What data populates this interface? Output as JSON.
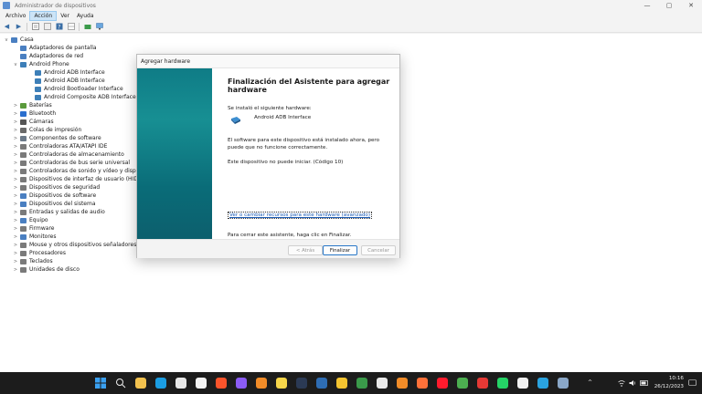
{
  "window": {
    "title": "Administrador de dispositivos",
    "min": "—",
    "max": "▢",
    "close": "✕"
  },
  "menu": [
    "Archivo",
    "Acción",
    "Ver",
    "Ayuda"
  ],
  "toolbar_icons": [
    "back-arrow-icon",
    "forward-arrow-icon",
    "properties-icon",
    "list-icon",
    "help-icon",
    "grid-icon",
    "update-driver-icon",
    "monitor-scan-icon"
  ],
  "tree": {
    "root": "Casa",
    "items": [
      {
        "label": "Adaptadores de pantalla",
        "expander": "",
        "color": "#4a7fc1"
      },
      {
        "label": "Adaptadores de red",
        "expander": "",
        "color": "#4a7fc1"
      },
      {
        "label": "Android Phone",
        "expander": "v",
        "color": "#3d7fb8"
      },
      {
        "label": "Android ADB Interface",
        "expander": "",
        "color": "#3d7fb8",
        "child": true
      },
      {
        "label": "Android ADB Interface",
        "expander": "",
        "color": "#3d7fb8",
        "child": true
      },
      {
        "label": "Android Bootloader Interface",
        "expander": "",
        "color": "#3d7fb8",
        "child": true
      },
      {
        "label": "Android Composite ADB Interface",
        "expander": "",
        "color": "#3d7fb8",
        "child": true
      },
      {
        "label": "Baterías",
        "expander": ">",
        "color": "#5a9a3c"
      },
      {
        "label": "Bluetooth",
        "expander": ">",
        "color": "#2b6fce"
      },
      {
        "label": "Cámaras",
        "expander": ">",
        "color": "#555555"
      },
      {
        "label": "Colas de impresión",
        "expander": ">",
        "color": "#6a6a6a"
      },
      {
        "label": "Componentes de software",
        "expander": ">",
        "color": "#6c7a89"
      },
      {
        "label": "Controladoras ATA/ATAPI IDE",
        "expander": ">",
        "color": "#7a7a7a"
      },
      {
        "label": "Controladoras de almacenamiento",
        "expander": ">",
        "color": "#7a7a7a"
      },
      {
        "label": "Controladoras de bus serie universal",
        "expander": ">",
        "color": "#7a7a7a"
      },
      {
        "label": "Controladoras de sonido y vídeo y dispositivos de juego",
        "expander": ">",
        "color": "#7a7a7a"
      },
      {
        "label": "Dispositivos de interfaz de usuario (HID)",
        "expander": ">",
        "color": "#7a7a7a"
      },
      {
        "label": "Dispositivos de seguridad",
        "expander": ">",
        "color": "#7a7a7a"
      },
      {
        "label": "Dispositivos de software",
        "expander": ">",
        "color": "#4a7fc1"
      },
      {
        "label": "Dispositivos del sistema",
        "expander": ">",
        "color": "#4a7fc1"
      },
      {
        "label": "Entradas y salidas de audio",
        "expander": ">",
        "color": "#7a7a7a"
      },
      {
        "label": "Equipo",
        "expander": ">",
        "color": "#4a7fc1"
      },
      {
        "label": "Firmware",
        "expander": ">",
        "color": "#7a7a7a"
      },
      {
        "label": "Monitores",
        "expander": ">",
        "color": "#4a7fc1"
      },
      {
        "label": "Mouse y otros dispositivos señaladores",
        "expander": ">",
        "color": "#7a7a7a"
      },
      {
        "label": "Procesadores",
        "expander": ">",
        "color": "#7a7a7a"
      },
      {
        "label": "Teclados",
        "expander": ">",
        "color": "#7a7a7a"
      },
      {
        "label": "Unidades de disco",
        "expander": ">",
        "color": "#7a7a7a"
      }
    ]
  },
  "dialog": {
    "title": "Agregar hardware",
    "heading": "Finalización del Asistente para agregar hardware",
    "installed_label": "Se instaló el siguiente hardware:",
    "device_name": "Android ADB Interface",
    "warning_line1": "El software para este dispositivo está instalado ahora, pero",
    "warning_line2": "puede que no funcione correctamente.",
    "error": "Este dispositivo no puede iniciar. (Código 10)",
    "link": "Ver o cambiar recursos para este hardware (avanzado)",
    "finish_hint": "Para cerrar este asistente, haga clic en Finalizar.",
    "btn_back": "< Atrás",
    "btn_finish": "Finalizar",
    "btn_cancel": "Cancelar"
  },
  "taskbar": {
    "icons": [
      {
        "name": "start-icon",
        "color": "#3aa0f0"
      },
      {
        "name": "search-icon",
        "color": "#1c1c1c"
      },
      {
        "name": "file-explorer-icon",
        "color": "#f2c14e"
      },
      {
        "name": "edge-icon",
        "color": "#1b9de2"
      },
      {
        "name": "notepad-icon",
        "color": "#e8e8e8"
      },
      {
        "name": "app-l-icon",
        "color": "#f4f4f4"
      },
      {
        "name": "brave-icon",
        "color": "#fb542b"
      },
      {
        "name": "vivaldi-icon",
        "color": "#8b5cf6"
      },
      {
        "name": "key-icon",
        "color": "#f28c28"
      },
      {
        "name": "sticky-notes-icon",
        "color": "#f7d64a"
      },
      {
        "name": "photoshop-icon",
        "color": "#2b3a55"
      },
      {
        "name": "inkscape-icon",
        "color": "#2e6db4"
      },
      {
        "name": "triangle-app-icon",
        "color": "#f4c430"
      },
      {
        "name": "globe-app-icon",
        "color": "#3a9a4a"
      },
      {
        "name": "obs-icon",
        "color": "#e9e9e9"
      },
      {
        "name": "vlc-icon",
        "color": "#f28c28"
      },
      {
        "name": "firefox-icon",
        "color": "#ff7139"
      },
      {
        "name": "opera-icon",
        "color": "#ff1b2d"
      },
      {
        "name": "chrome-icon",
        "color": "#4caf50"
      },
      {
        "name": "flag-app-icon",
        "color": "#e53935"
      },
      {
        "name": "whatsapp-icon",
        "color": "#25d366"
      },
      {
        "name": "capcut-icon",
        "color": "#f0f0f0"
      },
      {
        "name": "telegram-icon",
        "color": "#2aa3e0"
      },
      {
        "name": "device-manager-icon",
        "color": "#8aa7c8"
      }
    ],
    "tray_chevron": "^",
    "time": "10:16",
    "date": "26/12/2023"
  }
}
